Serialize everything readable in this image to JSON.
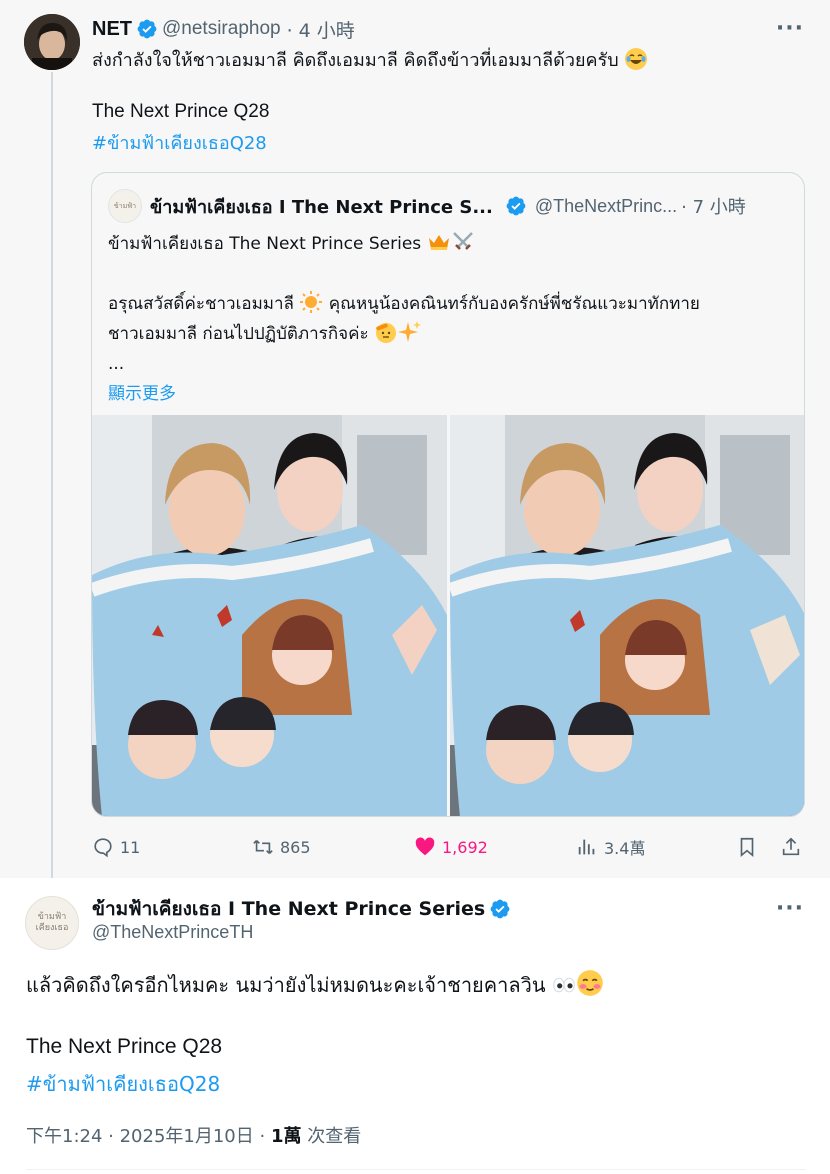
{
  "parent_tweet": {
    "name": "NET",
    "handle": "@netsiraphop",
    "time": "· 4 小時",
    "text": "ส่งกำลังใจให้ชาวเอมมาลี คิดถึงเอมมาลี คิดถึงข้าวที่เอมมาลีด้วยครับ",
    "line2": "The Next Prince Q28",
    "hashtag": "#ข้ามฟ้าเคียงเธอQ28",
    "more_icon": "···",
    "quote": {
      "name": "ข้ามฟ้าเคียงเธอ I The Next Prince S...",
      "handle": "@TheNextPrinc...",
      "time": "· 7 小時",
      "line1": "ข้ามฟ้าเคียงเธอ The Next Prince Series",
      "line2": "อรุณสวัสดิ์ค่ะชาวเอมมาลี",
      "line2b": "คุณหนูน้องคณินทร์กับองครักษ์พี่ชรัณแวะมาทักทาย",
      "line3": "ชาวเอมมาลี ก่อนไปปฏิบัติภารกิจค่ะ",
      "ellipsis": "...",
      "show_more": "顯示更多",
      "avatar_text": "ข้ามฟ้า"
    },
    "actions": {
      "replies": "11",
      "retweets": "865",
      "likes": "1,692",
      "views": "3.4萬"
    }
  },
  "main_tweet": {
    "name": "ข้ามฟ้าเคียงเธอ I The Next Prince Series",
    "handle": "@TheNextPrinceTH",
    "avatar_text_1": "ข้ามฟ้า",
    "avatar_text_2": "เคียงเธอ",
    "text": "แล้วคิดถึงใครอีกไหมคะ นมว่ายังไม่หมดนะคะเจ้าชายคาลวิน",
    "line2": "The Next Prince Q28",
    "hashtag": "#ข้ามฟ้าเคียงเธอQ28",
    "timestamp": "下午1:24 · 2025年1月10日 ·",
    "views_count": "1萬",
    "views_label": "次查看",
    "more_icon": "···"
  },
  "colors": {
    "accent": "#1d9bf0",
    "like": "#f91880",
    "muted": "#536471"
  },
  "icons": [
    "verified-badge-icon",
    "reply-icon",
    "retweet-icon",
    "heart-icon",
    "views-icon",
    "bookmark-icon",
    "share-icon",
    "more-icon"
  ]
}
